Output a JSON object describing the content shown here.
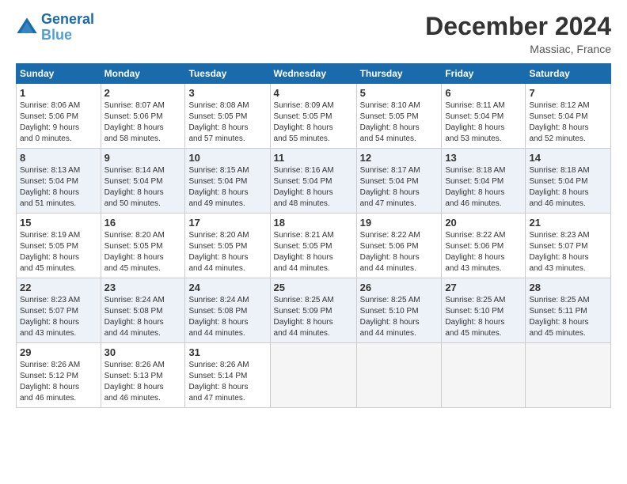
{
  "header": {
    "logo_line1": "General",
    "logo_line2": "Blue",
    "month": "December 2024",
    "location": "Massiac, France"
  },
  "weekdays": [
    "Sunday",
    "Monday",
    "Tuesday",
    "Wednesday",
    "Thursday",
    "Friday",
    "Saturday"
  ],
  "weeks": [
    [
      {
        "day": "1",
        "info": "Sunrise: 8:06 AM\nSunset: 5:06 PM\nDaylight: 9 hours\nand 0 minutes."
      },
      {
        "day": "2",
        "info": "Sunrise: 8:07 AM\nSunset: 5:06 PM\nDaylight: 8 hours\nand 58 minutes."
      },
      {
        "day": "3",
        "info": "Sunrise: 8:08 AM\nSunset: 5:05 PM\nDaylight: 8 hours\nand 57 minutes."
      },
      {
        "day": "4",
        "info": "Sunrise: 8:09 AM\nSunset: 5:05 PM\nDaylight: 8 hours\nand 55 minutes."
      },
      {
        "day": "5",
        "info": "Sunrise: 8:10 AM\nSunset: 5:05 PM\nDaylight: 8 hours\nand 54 minutes."
      },
      {
        "day": "6",
        "info": "Sunrise: 8:11 AM\nSunset: 5:04 PM\nDaylight: 8 hours\nand 53 minutes."
      },
      {
        "day": "7",
        "info": "Sunrise: 8:12 AM\nSunset: 5:04 PM\nDaylight: 8 hours\nand 52 minutes."
      }
    ],
    [
      {
        "day": "8",
        "info": "Sunrise: 8:13 AM\nSunset: 5:04 PM\nDaylight: 8 hours\nand 51 minutes."
      },
      {
        "day": "9",
        "info": "Sunrise: 8:14 AM\nSunset: 5:04 PM\nDaylight: 8 hours\nand 50 minutes."
      },
      {
        "day": "10",
        "info": "Sunrise: 8:15 AM\nSunset: 5:04 PM\nDaylight: 8 hours\nand 49 minutes."
      },
      {
        "day": "11",
        "info": "Sunrise: 8:16 AM\nSunset: 5:04 PM\nDaylight: 8 hours\nand 48 minutes."
      },
      {
        "day": "12",
        "info": "Sunrise: 8:17 AM\nSunset: 5:04 PM\nDaylight: 8 hours\nand 47 minutes."
      },
      {
        "day": "13",
        "info": "Sunrise: 8:18 AM\nSunset: 5:04 PM\nDaylight: 8 hours\nand 46 minutes."
      },
      {
        "day": "14",
        "info": "Sunrise: 8:18 AM\nSunset: 5:04 PM\nDaylight: 8 hours\nand 46 minutes."
      }
    ],
    [
      {
        "day": "15",
        "info": "Sunrise: 8:19 AM\nSunset: 5:05 PM\nDaylight: 8 hours\nand 45 minutes."
      },
      {
        "day": "16",
        "info": "Sunrise: 8:20 AM\nSunset: 5:05 PM\nDaylight: 8 hours\nand 45 minutes."
      },
      {
        "day": "17",
        "info": "Sunrise: 8:20 AM\nSunset: 5:05 PM\nDaylight: 8 hours\nand 44 minutes."
      },
      {
        "day": "18",
        "info": "Sunrise: 8:21 AM\nSunset: 5:05 PM\nDaylight: 8 hours\nand 44 minutes."
      },
      {
        "day": "19",
        "info": "Sunrise: 8:22 AM\nSunset: 5:06 PM\nDaylight: 8 hours\nand 44 minutes."
      },
      {
        "day": "20",
        "info": "Sunrise: 8:22 AM\nSunset: 5:06 PM\nDaylight: 8 hours\nand 43 minutes."
      },
      {
        "day": "21",
        "info": "Sunrise: 8:23 AM\nSunset: 5:07 PM\nDaylight: 8 hours\nand 43 minutes."
      }
    ],
    [
      {
        "day": "22",
        "info": "Sunrise: 8:23 AM\nSunset: 5:07 PM\nDaylight: 8 hours\nand 43 minutes."
      },
      {
        "day": "23",
        "info": "Sunrise: 8:24 AM\nSunset: 5:08 PM\nDaylight: 8 hours\nand 44 minutes."
      },
      {
        "day": "24",
        "info": "Sunrise: 8:24 AM\nSunset: 5:08 PM\nDaylight: 8 hours\nand 44 minutes."
      },
      {
        "day": "25",
        "info": "Sunrise: 8:25 AM\nSunset: 5:09 PM\nDaylight: 8 hours\nand 44 minutes."
      },
      {
        "day": "26",
        "info": "Sunrise: 8:25 AM\nSunset: 5:10 PM\nDaylight: 8 hours\nand 44 minutes."
      },
      {
        "day": "27",
        "info": "Sunrise: 8:25 AM\nSunset: 5:10 PM\nDaylight: 8 hours\nand 45 minutes."
      },
      {
        "day": "28",
        "info": "Sunrise: 8:25 AM\nSunset: 5:11 PM\nDaylight: 8 hours\nand 45 minutes."
      }
    ],
    [
      {
        "day": "29",
        "info": "Sunrise: 8:26 AM\nSunset: 5:12 PM\nDaylight: 8 hours\nand 46 minutes."
      },
      {
        "day": "30",
        "info": "Sunrise: 8:26 AM\nSunset: 5:13 PM\nDaylight: 8 hours\nand 46 minutes."
      },
      {
        "day": "31",
        "info": "Sunrise: 8:26 AM\nSunset: 5:14 PM\nDaylight: 8 hours\nand 47 minutes."
      },
      null,
      null,
      null,
      null
    ]
  ]
}
